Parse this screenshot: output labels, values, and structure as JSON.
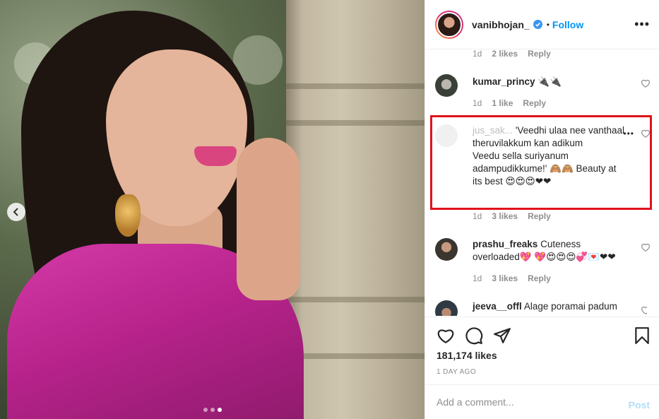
{
  "header": {
    "username": "vanibhojan_",
    "separator": "•",
    "follow_label": "Follow",
    "more_icon": "more-horizontal-icon"
  },
  "comments": [
    {
      "meta": {
        "time": "1d",
        "likes": "2 likes",
        "reply": "Reply"
      }
    },
    {
      "user": "kumar_princy",
      "text": "🔌🔌",
      "meta": {
        "time": "1d",
        "likes": "1 like",
        "reply": "Reply"
      }
    },
    {
      "user": "jus_sak...",
      "text": "'Veedhi ulaa nee vanthaal theruvilakkum kan adikum\nVeedu sella suriyanum adampudikkume!' 🙈🙈 Beauty at its best 😍😍😍❤❤",
      "meta": {
        "time": "1d",
        "likes": "3 likes",
        "reply": "Reply"
      }
    },
    {
      "user": "prashu_freaks",
      "text": "Cuteness overloaded💖 💖😍😍😍💞💌❤❤",
      "meta": {
        "time": "1d",
        "likes": "3 likes",
        "reply": "Reply"
      }
    },
    {
      "user": "jeeva__offl",
      "text": "Alage poramai padum"
    }
  ],
  "actions": {
    "likes_count": "181,174 likes",
    "time_ago": "1 DAY AGO"
  },
  "add_comment": {
    "placeholder": "Add a comment...",
    "post_label": "Post"
  },
  "colors": {
    "accent": "#0095f6",
    "highlight_box": "#e0121b",
    "muted_text": "#8e8e8e"
  },
  "carousel": {
    "slide_count": 3,
    "active_index": 2
  }
}
